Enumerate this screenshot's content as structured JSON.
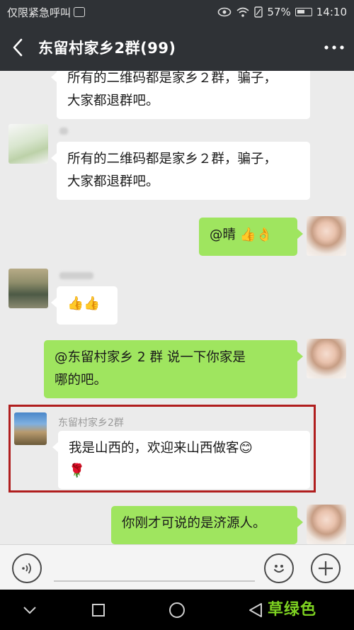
{
  "status_bar": {
    "left_text": "仅限紧急呼叫",
    "battery": "57%",
    "time": "14:10"
  },
  "header": {
    "title": "东留村家乡2群(99)",
    "back_icon": "chevron-left-icon",
    "more_icon": "more-dots-icon"
  },
  "messages": [
    {
      "side": "left",
      "lines": [
        "所有的二维码都是家乡２群，骗子，",
        "大家都退群吧。"
      ]
    },
    {
      "side": "left",
      "lines": [
        "所有的二维码都是家乡２群，骗子，",
        "大家都退群吧。"
      ]
    },
    {
      "side": "right",
      "text": "@晴 👍👌"
    },
    {
      "side": "left",
      "text": "👍👍"
    },
    {
      "side": "right",
      "lines": [
        "@东留村家乡 2 群  说一下你家是",
        "哪的吧。"
      ]
    },
    {
      "side": "left",
      "nickname": "东留村家乡2群",
      "lines": [
        "我是山西的，欢迎来山西做客😊",
        "🌹"
      ]
    },
    {
      "side": "right",
      "text": "你刚才可说的是济源人。"
    }
  ],
  "input_bar": {
    "voice_icon": "voice-icon",
    "emoji_icon": "emoji-icon",
    "plus_icon": "plus-icon"
  },
  "nav_bar": {
    "back_icon": "nav-back-icon",
    "home_icon": "nav-home-icon",
    "recents_icon": "nav-recents-icon",
    "down_icon": "nav-down-icon"
  },
  "watermark": "草绿色",
  "colors": {
    "header_bg": "#2f3236",
    "chat_bg": "#ebebeb",
    "right_bubble": "#9fe55f",
    "left_bubble": "#ffffff",
    "highlight": "#b01e1e",
    "watermark": "#7ed321"
  }
}
